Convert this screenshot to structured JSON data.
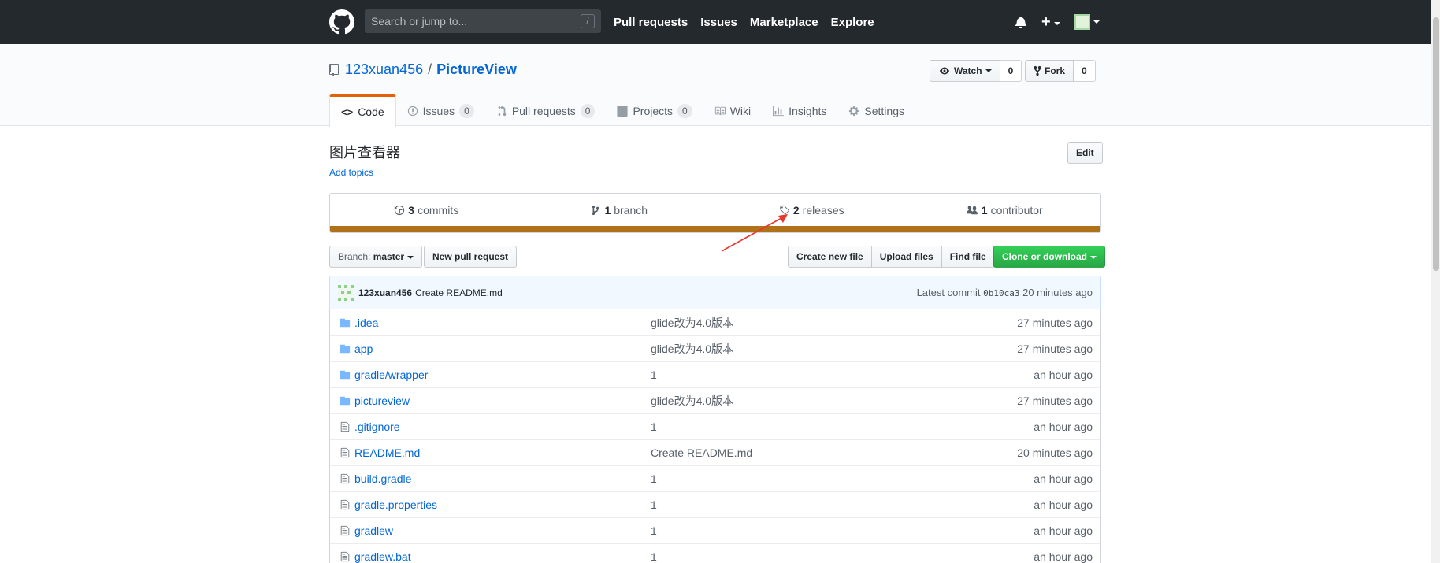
{
  "header": {
    "search_placeholder": "Search or jump to...",
    "search_shortcut": "/",
    "nav": [
      "Pull requests",
      "Issues",
      "Marketplace",
      "Explore"
    ],
    "plus_label": "+"
  },
  "repo": {
    "owner": "123xuan456",
    "separator": "/",
    "name": "PictureView",
    "watch_label": "Watch",
    "watch_count": "0",
    "fork_label": "Fork",
    "fork_count": "0"
  },
  "tabs": [
    {
      "label": "Code"
    },
    {
      "label": "Issues",
      "count": "0"
    },
    {
      "label": "Pull requests",
      "count": "0"
    },
    {
      "label": "Projects",
      "count": "0"
    },
    {
      "label": "Wiki"
    },
    {
      "label": "Insights"
    },
    {
      "label": "Settings"
    }
  ],
  "description": "图片查看器",
  "add_topics": "Add topics",
  "edit_label": "Edit",
  "summary": {
    "commits_num": "3",
    "commits_label": "commits",
    "branch_num": "1",
    "branch_label": "branch",
    "releases_num": "2",
    "releases_label": "releases",
    "contributor_num": "1",
    "contributor_label": "contributor"
  },
  "language_color": "#b07219",
  "file_nav": {
    "branch_prefix": "Branch:",
    "branch_name": "master",
    "new_pr": "New pull request",
    "create_file": "Create new file",
    "upload_files": "Upload files",
    "find_file": "Find file",
    "clone": "Clone or download"
  },
  "commit": {
    "author": "123xuan456",
    "message": "Create README.md",
    "latest_label": "Latest commit",
    "sha": "0b10ca3",
    "age": "20 minutes ago"
  },
  "files": [
    {
      "type": "dir",
      "name": ".idea",
      "message": "glide改为4.0版本",
      "age": "27 minutes ago"
    },
    {
      "type": "dir",
      "name": "app",
      "message": "glide改为4.0版本",
      "age": "27 minutes ago"
    },
    {
      "type": "dir",
      "name": "gradle/wrapper",
      "message": "1",
      "age": "an hour ago"
    },
    {
      "type": "dir",
      "name": "pictureview",
      "message": "glide改为4.0版本",
      "age": "27 minutes ago"
    },
    {
      "type": "file",
      "name": ".gitignore",
      "message": "1",
      "age": "an hour ago"
    },
    {
      "type": "file",
      "name": "README.md",
      "message": "Create README.md",
      "age": "20 minutes ago"
    },
    {
      "type": "file",
      "name": "build.gradle",
      "message": "1",
      "age": "an hour ago"
    },
    {
      "type": "file",
      "name": "gradle.properties",
      "message": "1",
      "age": "an hour ago"
    },
    {
      "type": "file",
      "name": "gradlew",
      "message": "1",
      "age": "an hour ago"
    },
    {
      "type": "file",
      "name": "gradlew.bat",
      "message": "1",
      "age": "an hour ago"
    }
  ],
  "colors": {
    "header_bg": "#24292e",
    "link": "#0366d6",
    "tab_accent": "#e36209",
    "primary_green": "#28a745",
    "annotation_arrow": "#e8372b"
  }
}
